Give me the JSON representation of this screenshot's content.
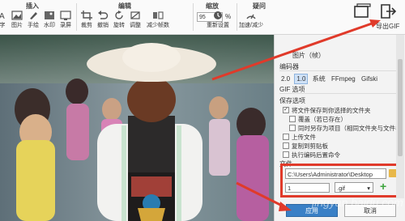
{
  "colors": {
    "annotation_red": "#e03a2a",
    "apply_blue": "#3a80c6",
    "add_green": "#3ba33b"
  },
  "ribbon": {
    "insert": {
      "title": "插入",
      "tools": [
        {
          "label": "字",
          "icon": "text-icon"
        },
        {
          "label": "图片",
          "icon": "image-icon"
        },
        {
          "label": "手绘",
          "icon": "pen-icon"
        },
        {
          "label": "水印",
          "icon": "watermark-icon"
        },
        {
          "label": "录屏",
          "icon": "record-icon"
        }
      ]
    },
    "edit": {
      "title": "编辑",
      "tools": [
        {
          "label": "裁剪",
          "icon": "crop-icon"
        },
        {
          "label": "撤销",
          "icon": "undo-icon"
        },
        {
          "label": "旋转",
          "icon": "rotate-icon"
        },
        {
          "label": "调整",
          "icon": "adjust-icon"
        },
        {
          "label": "减少帧数",
          "icon": "reduce-frames-icon"
        }
      ]
    },
    "zoom": {
      "title": "缩放",
      "value": "95",
      "unit": "%"
    },
    "other": {
      "title": "疑问",
      "tools": [
        {
          "label": "重新设置",
          "icon": "reset-icon"
        },
        {
          "label": "加速/减少",
          "icon": "speed-icon"
        }
      ]
    },
    "export": {
      "label": "导出GIF"
    }
  },
  "panel": {
    "tab": "图片（帧）",
    "encoder": {
      "title": "编码器",
      "options": [
        "2.0",
        "1.0",
        "系统",
        "FFmpeg",
        "Gifski"
      ],
      "selected": "1.0"
    },
    "gif_options_title": "GIF 选项",
    "save_options": {
      "title": "保存选项",
      "items": [
        {
          "label": "将文件保存到你选择的文件夹",
          "checked": true
        },
        {
          "label": "覆盖（若已存在）",
          "checked": false
        },
        {
          "label": "同时另存为项目（相同文件夹与文件名）",
          "checked": false
        },
        {
          "label": "上传文件",
          "checked": false
        },
        {
          "label": "复制到剪贴板",
          "checked": false
        },
        {
          "label": "执行编码后置命令",
          "checked": false
        }
      ]
    },
    "file_title": "文件",
    "path_value": "C:\\Users\\Administrator\\Desktop",
    "filename_value": "1",
    "format_value": ".gif",
    "add_symbol": "+",
    "apply_label": "应用",
    "cancel_label": "取消"
  },
  "watermark": "jingyan.baidu.com"
}
